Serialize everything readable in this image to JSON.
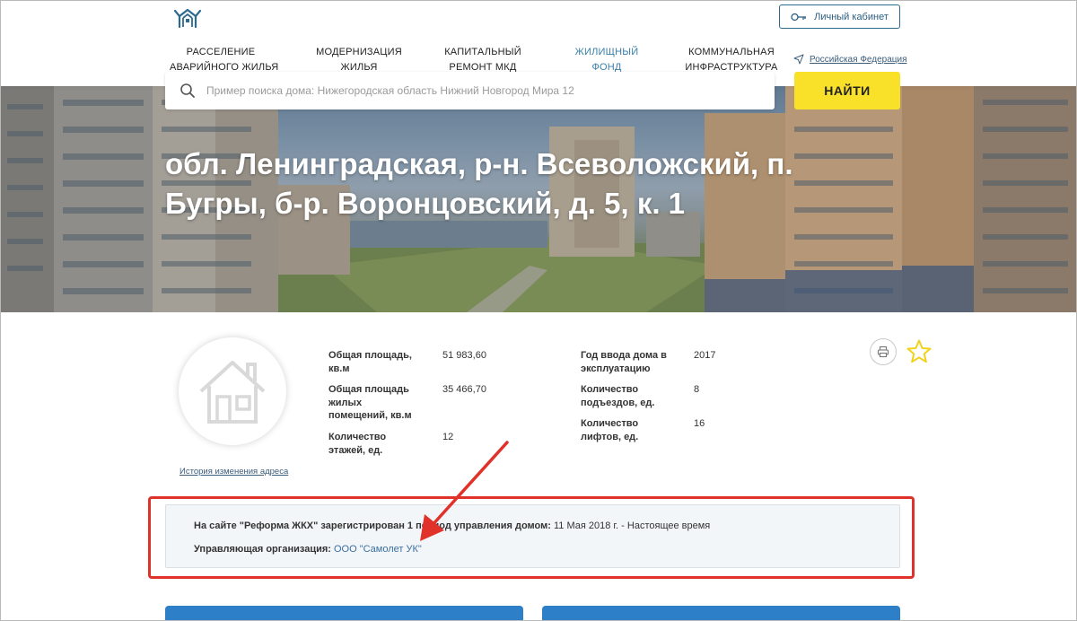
{
  "header": {
    "cabinet_label": "Личный кабинет",
    "nav": [
      {
        "line1": "РАССЕЛЕНИЕ",
        "line2": "АВАРИЙНОГО ЖИЛЬЯ"
      },
      {
        "line1": "МОДЕРНИЗАЦИЯ",
        "line2": "ЖИЛЬЯ"
      },
      {
        "line1": "КАПИТАЛЬНЫЙ",
        "line2": "РЕМОНТ МКД"
      },
      {
        "line1": "ЖИЛИЩНЫЙ",
        "line2": "ФОНД"
      },
      {
        "line1": "КОММУНАЛЬНАЯ",
        "line2": "ИНФРАСТРУКТУРА"
      }
    ],
    "region_label": "Российская Федерация"
  },
  "search": {
    "placeholder": "Пример поиска дома: Нижегородская область Нижний Новгород Мира 12",
    "button_label": "НАЙТИ"
  },
  "address": {
    "title": "обл. Ленинградская, р-н. Всеволожский, п. Бугры, б-р. Воронцовский, д. 5, к. 1"
  },
  "house": {
    "history_link": "История изменения адреса",
    "props_left": [
      {
        "label1": "Общая площадь,",
        "label2": "кв.м",
        "label3": "",
        "value": "51 983,60"
      },
      {
        "label1": "Общая площадь",
        "label2": "жилых",
        "label3": "помещений, кв.м",
        "value": "35 466,70"
      },
      {
        "label1": "Количество",
        "label2": "этажей, ед.",
        "label3": "",
        "value": "12"
      }
    ],
    "props_right": [
      {
        "label1": "Год ввода дома в",
        "label2": "эксплуатацию",
        "value": "2017"
      },
      {
        "label1": "Количество",
        "label2": "подъездов, ед.",
        "value": "8"
      },
      {
        "label1": "Количество",
        "label2": "лифтов, ед.",
        "value": "16"
      }
    ]
  },
  "management": {
    "period_prefix": "На сайте \"Реформа ЖКХ\" зарегистрирован 1 период управления домом:",
    "period_value": "11 Мая 2018 г. - Настоящее время",
    "org_prefix": "Управляющая организация:",
    "org_name": "ООО \"Самолет УК\""
  },
  "colors": {
    "accent": "#2c6a8e",
    "search_button": "#f9e12a",
    "highlight": "#e0322b",
    "card": "#2d7fc8"
  },
  "icons": [
    "logo-icon",
    "key-icon",
    "location-arrow-icon",
    "search-icon",
    "house-icon",
    "printer-icon",
    "star-icon"
  ]
}
